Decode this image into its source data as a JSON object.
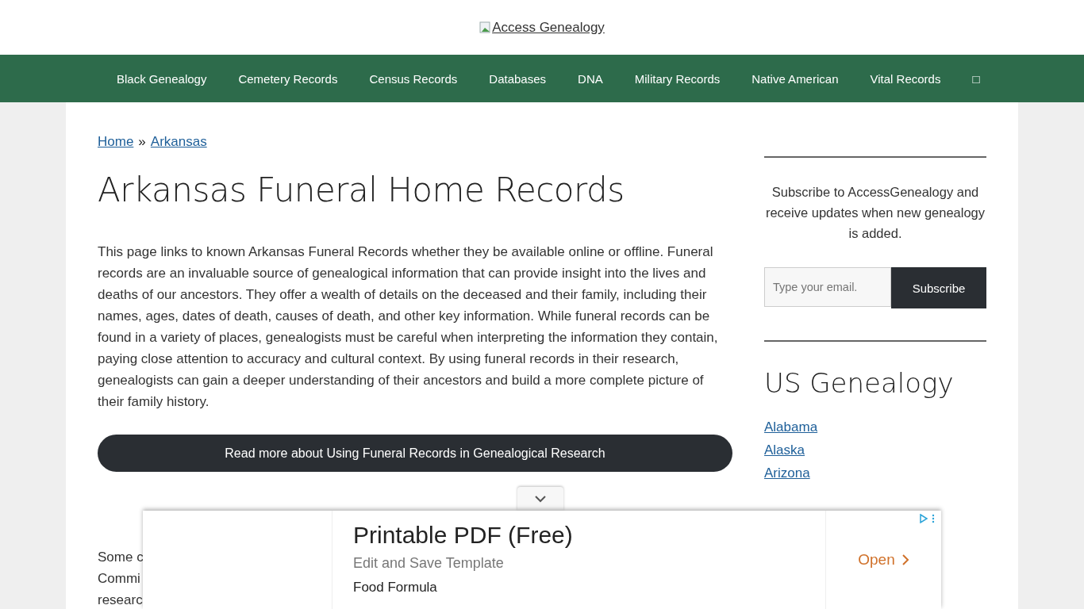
{
  "logo": {
    "alt": "Access Genealogy"
  },
  "nav": [
    "Black Genealogy",
    "Cemetery Records",
    "Census Records",
    "Databases",
    "DNA",
    "Military Records",
    "Native American",
    "Vital Records",
    "□"
  ],
  "breadcrumb": [
    {
      "label": "Home"
    },
    {
      "label": "Arkansas"
    }
  ],
  "breadcrumb_separator": "»",
  "title": "Arkansas Funeral Home Records",
  "intro": "This page links to known Arkansas Funeral Records whether they be available online or offline. Funeral records are an invaluable source of genealogical information that can provide insight into the lives and deaths of our ancestors. They offer a wealth of details on the deceased and their family, including their names, ages, dates of death, causes of death, and other key information. While funeral records can be found in a variety of places, genealogists must be careful when interpreting the information they contain, paying close attention to accuracy and cultural context. By using funeral records in their research, genealogists can gain a deeper understanding of their ancestors and build a more complete picture of their family history.",
  "read_more_button": "Read more about Using Funeral Records in Genealogical Research",
  "partial_lines": [
    "Some c",
    "Commi",
    "researc"
  ],
  "sidebar": {
    "subscribe_text": "Subscribe to AccessGenealogy and receive updates when new genealogy is added.",
    "email_placeholder": "Type your email.",
    "subscribe_button": "Subscribe",
    "heading": "US Genealogy",
    "links": [
      "Alabama",
      "Alaska",
      "Arizona"
    ]
  },
  "ad": {
    "headline": "Printable PDF (Free)",
    "subline": "Edit and Save Template",
    "advertiser": "Food Formula",
    "cta": "Open"
  }
}
